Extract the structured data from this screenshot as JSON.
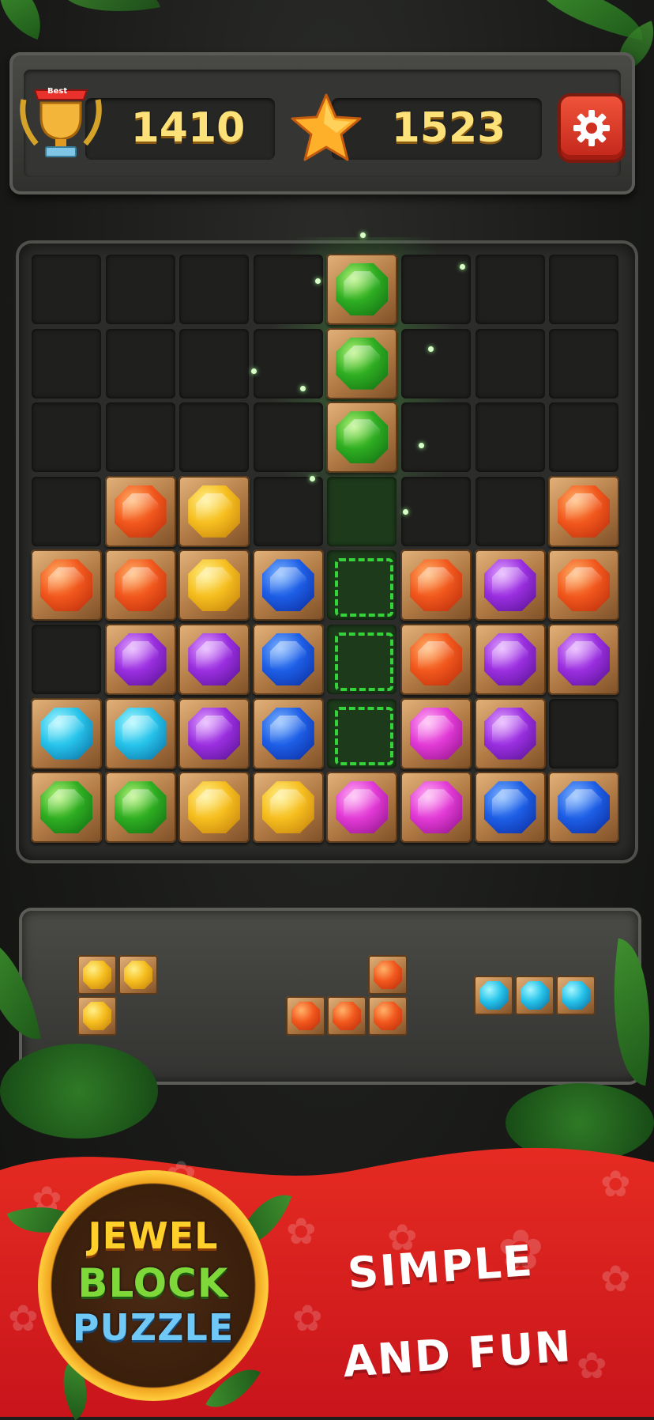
{
  "header": {
    "best_badge": "Best",
    "best_score": "1410",
    "current_score": "1523",
    "trophy_icon": "trophy-icon",
    "star_icon": "star-icon",
    "settings_icon": "gear-icon"
  },
  "board": {
    "rows": 8,
    "cols": 8,
    "cells": [
      [
        "",
        "",
        "",
        "",
        "",
        "",
        "",
        ""
      ],
      [
        "",
        "",
        "",
        "",
        "",
        "",
        "",
        ""
      ],
      [
        "",
        "",
        "",
        "",
        "",
        "",
        "",
        ""
      ],
      [
        "",
        "orange",
        "yellow",
        "",
        "",
        "",
        "",
        "orange"
      ],
      [
        "orange",
        "orange",
        "yellow",
        "blue",
        "",
        "orange",
        "purple",
        "orange"
      ],
      [
        "",
        "purple",
        "purple",
        "blue",
        "",
        "orange",
        "purple",
        "purple"
      ],
      [
        "cyan",
        "cyan",
        "purple",
        "blue",
        "",
        "pink",
        "purple",
        ""
      ],
      [
        "green",
        "green",
        "yellow",
        "yellow",
        "pink",
        "pink",
        "blue",
        "blue"
      ]
    ],
    "dragging_piece": {
      "color": "green",
      "col": 4,
      "rows": [
        0,
        1,
        2
      ]
    },
    "drop_target": {
      "col": 4,
      "rows": [
        4,
        5,
        6
      ]
    }
  },
  "tray": {
    "pieces": [
      {
        "name": "piece-yellow-l",
        "color": "yellow"
      },
      {
        "name": "piece-orange-j",
        "color": "orange"
      },
      {
        "name": "piece-cyan-line",
        "color": "cyan"
      }
    ]
  },
  "banner": {
    "logo_line1": "JEWEL",
    "logo_line2": "BLOCK",
    "logo_line3": "PUZZLE",
    "tagline_line1": "SIMPLE",
    "tagline_line2": "AND FUN"
  },
  "colors": {
    "green": [
      "#b6f47a",
      "#2fae22",
      "#0f6a12"
    ],
    "orange": [
      "#ffb36a",
      "#f2581d",
      "#b72a0a"
    ],
    "yellow": [
      "#fff08a",
      "#f6be1f",
      "#c07c0a"
    ],
    "blue": [
      "#7fb6ff",
      "#1d5ee6",
      "#0b2a9a"
    ],
    "purple": [
      "#e3a8ff",
      "#9a2fe0",
      "#55108e"
    ],
    "cyan": [
      "#a8f7ff",
      "#26c3ea",
      "#0b6a9e"
    ],
    "pink": [
      "#ffb2f4",
      "#e23ad6",
      "#8c1185"
    ],
    "accent_red": "#e62c22",
    "score_yellow": "#fde27a"
  }
}
